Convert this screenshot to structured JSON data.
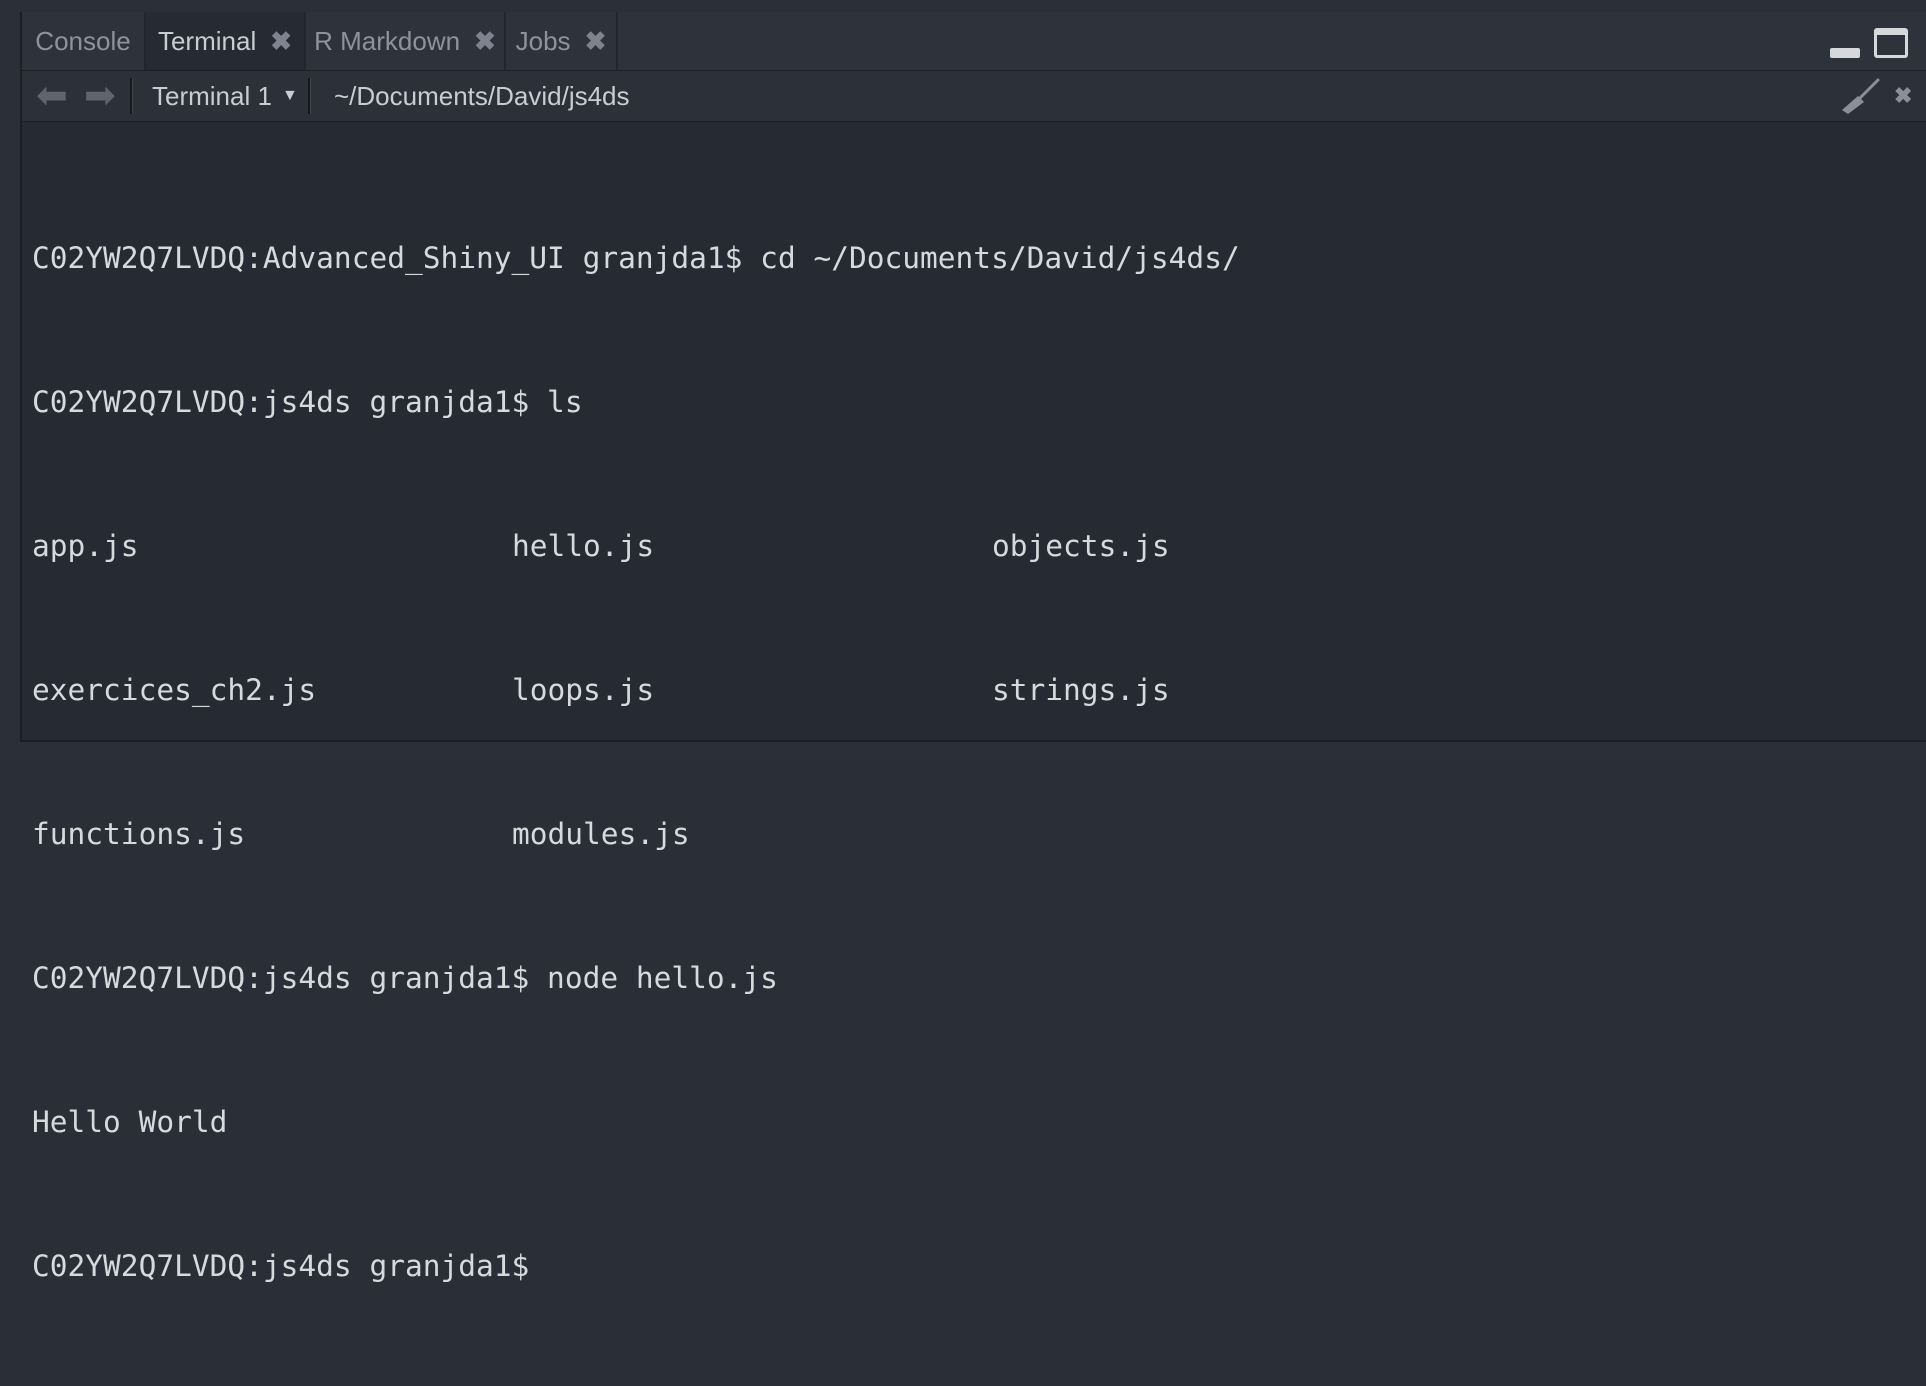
{
  "tabs": [
    {
      "label": "Console",
      "closable": false,
      "active": false
    },
    {
      "label": "Terminal",
      "closable": true,
      "active": true
    },
    {
      "label": "R Markdown",
      "closable": true,
      "active": false
    },
    {
      "label": "Jobs",
      "closable": true,
      "active": false
    }
  ],
  "tab_close_glyph": "✖",
  "toolbar": {
    "back_icon": "back-arrow-icon",
    "forward_icon": "forward-arrow-icon",
    "terminal_selector": "Terminal 1",
    "path": "~/Documents/David/js4ds",
    "clear_icon": "broom-icon",
    "close_icon": "close-icon"
  },
  "terminal": {
    "lines": [
      "C02YW2Q7LVDQ:Advanced_Shiny_UI granjda1$ cd ~/Documents/David/js4ds/",
      "C02YW2Q7LVDQ:js4ds granjda1$ ls"
    ],
    "ls_output": [
      [
        "app.js",
        "hello.js",
        "objects.js"
      ],
      [
        "exercices_ch2.js",
        "loops.js",
        "strings.js"
      ],
      [
        "functions.js",
        "modules.js",
        ""
      ]
    ],
    "after_lines": [
      "C02YW2Q7LVDQ:js4ds granjda1$ node hello.js",
      "Hello World",
      "C02YW2Q7LVDQ:js4ds granjda1$ "
    ]
  }
}
